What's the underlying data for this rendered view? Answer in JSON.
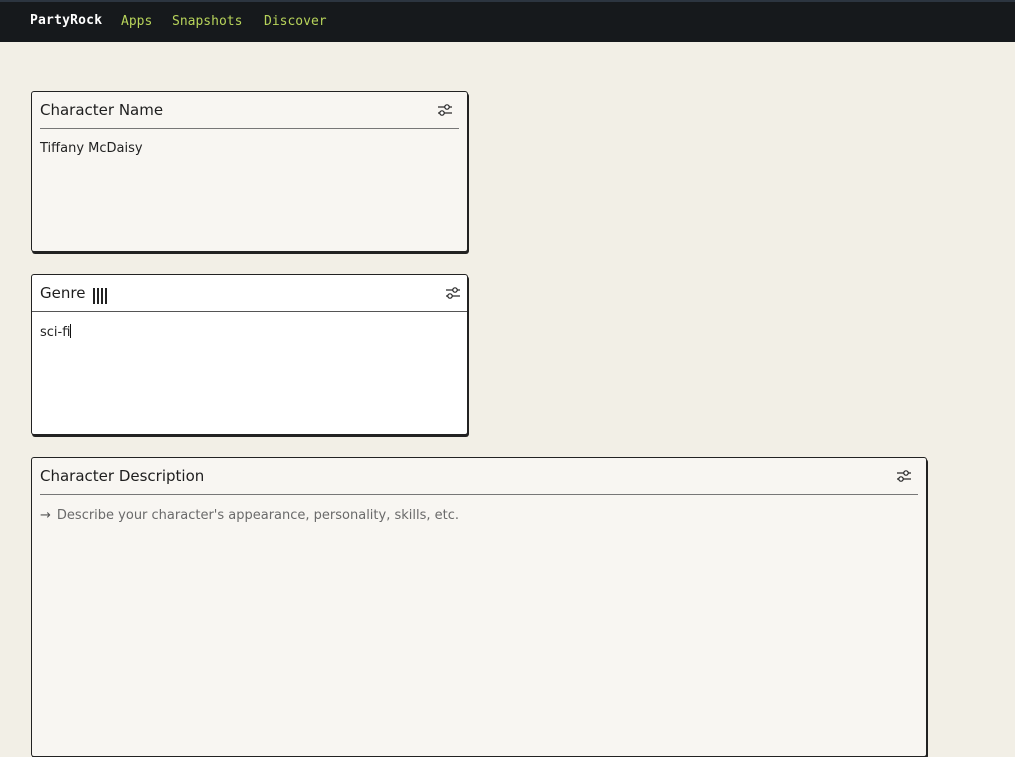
{
  "nav": {
    "brand": "PartyRock",
    "links": [
      "Apps",
      "Snapshots",
      "Discover"
    ]
  },
  "widgets": [
    {
      "title": "Character Name",
      "value": "Tiffany McDaisy",
      "settings_icon": "sliders-icon"
    },
    {
      "title": "Genre",
      "value": "sci-fi",
      "settings_icon": "sliders-icon",
      "drag_icon": "drag-handle-icon"
    },
    {
      "title": "Character Description",
      "placeholder": "Describe your character's appearance, personality, skills, etc.",
      "placeholder_icon": "arrow-right-icon",
      "settings_icon": "sliders-icon"
    }
  ],
  "colors": {
    "page_bg": "#f2efe6",
    "topbar_bg": "#16191c",
    "nav_link": "#b7d35a",
    "card_bg": "#f8f6f2",
    "active_card_bg": "#ffffff"
  }
}
